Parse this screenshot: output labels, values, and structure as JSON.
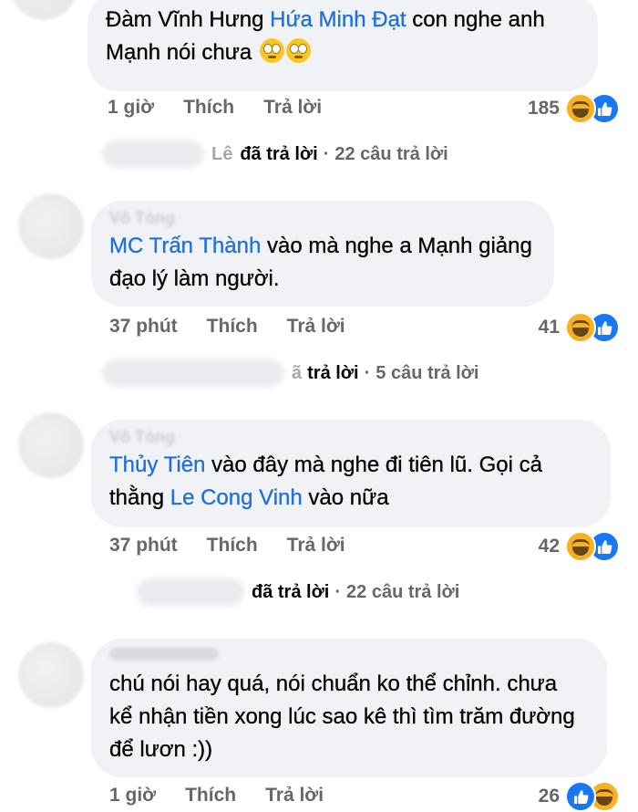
{
  "comments": [
    {
      "text_before": "Đàm Vĩnh Hưng ",
      "mention1": "Hứa Minh Đạt",
      "text_mid": " con nghe anh Mạnh nói chưa",
      "emoji": "🙄🙄",
      "time": "1 giờ",
      "like_label": "Thích",
      "reply_label": "Trả lời",
      "count": "185",
      "reply_name": "Lê",
      "reply_text": "đã trả lời",
      "reply_count": "22 câu trả lời"
    },
    {
      "author": "Võ Tòng",
      "mention1": "MC Trấn Thành",
      "text_mid": " vào mà nghe a Mạnh giảng đạo lý làm người.",
      "time": "37 phút",
      "like_label": "Thích",
      "reply_label": "Trả lời",
      "count": "41",
      "reply_name": "ã",
      "reply_text": "trả lời",
      "reply_count": "5 câu trả lời"
    },
    {
      "author": "Võ Tòng",
      "mention1": "Thủy Tiên",
      "text_mid": " vào đây mà nghe đi tiên lũ. Gọi cả thằng ",
      "mention2": "Le Cong Vinh",
      "text_end": " vào nữa",
      "time": "37 phút",
      "like_label": "Thích",
      "reply_label": "Trả lời",
      "count": "42",
      "reply_text": "đã trả lời",
      "reply_count": "22 câu trả lời"
    },
    {
      "text": "chú nói hay quá, nói chuẩn ko thể chỉnh. chưa kể nhận tiền xong lúc sao kê thì tìm trăm đường để lươn :))",
      "time": "1 giờ",
      "like_label": "Thích",
      "reply_label": "Trả lời",
      "count": "26"
    }
  ],
  "icons": {
    "haha": "haha-reaction-icon",
    "like": "like-reaction-icon"
  },
  "colors": {
    "mention": "#216fdb",
    "bubble": "#f0f2f5",
    "meta": "#65676b",
    "like": "#1877f2",
    "haha": "#f7b125"
  }
}
